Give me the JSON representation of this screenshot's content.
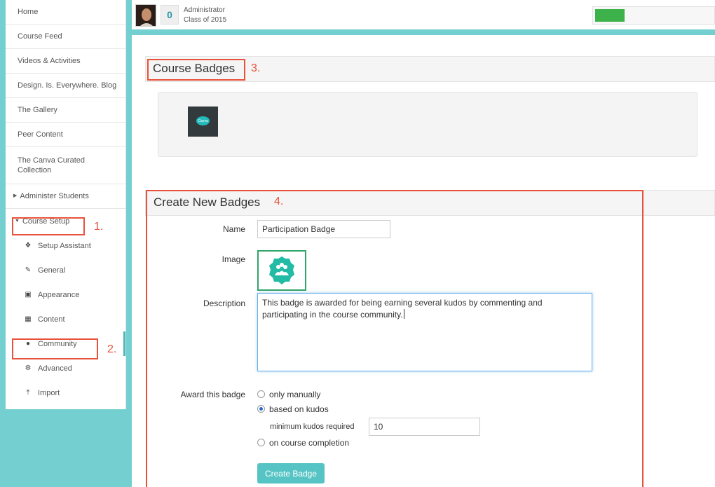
{
  "sidebar": {
    "items": [
      {
        "label": "Home"
      },
      {
        "label": "Course Feed"
      },
      {
        "label": "Videos & Activities"
      },
      {
        "label": "Design. Is. Everywhere. Blog"
      },
      {
        "label": "The Gallery"
      },
      {
        "label": "Peer Content"
      },
      {
        "label": "The Canva Curated Collection"
      },
      {
        "label": "Administer Students"
      },
      {
        "label": "Course Setup"
      }
    ],
    "sub_items": [
      {
        "label": "Setup Assistant",
        "icon": "info-icon"
      },
      {
        "label": "General",
        "icon": "edit-icon"
      },
      {
        "label": "Appearance",
        "icon": "image-icon"
      },
      {
        "label": "Content",
        "icon": "sitemap-icon"
      },
      {
        "label": "Community",
        "icon": "users-icon"
      },
      {
        "label": "Advanced",
        "icon": "gears-icon"
      },
      {
        "label": "Import",
        "icon": "upload-icon"
      }
    ]
  },
  "header": {
    "kudos": "0",
    "role": "Administrator",
    "class": "Class of 2015",
    "progress": 0.25
  },
  "annotations": [
    "1.",
    "2.",
    "3.",
    "4."
  ],
  "course_badges": {
    "title": "Course Badges",
    "badge_text": "Canva"
  },
  "create_badge": {
    "title": "Create New Badges",
    "name_label": "Name",
    "name_value": "Participation Badge",
    "image_label": "Image",
    "description_label": "Description",
    "description_value": "This badge is awarded for being earning several kudos by commenting and participating in the course community.",
    "award_label": "Award this badge",
    "options": [
      "only manually",
      "based on kudos",
      "on course completion"
    ],
    "selected_option": "based on kudos",
    "min_kudos_label": "minimum kudos required",
    "min_kudos_value": "10",
    "submit_label": "Create Badge"
  },
  "colors": {
    "accent": "#74cfd0",
    "button": "#56c4c4",
    "highlight": "#e8513a",
    "progress": "#3db14a"
  }
}
